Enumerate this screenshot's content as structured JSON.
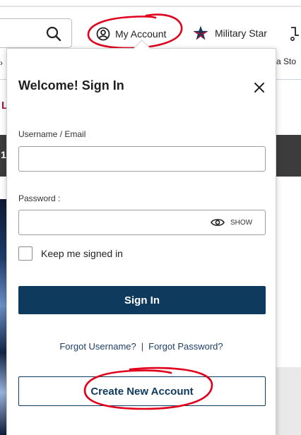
{
  "header": {
    "account_label": "My Account",
    "star_label": "Military Star"
  },
  "background": {
    "nav_left_glyph": "›",
    "nav_right_text": "a Sto",
    "red_letter": "L",
    "strip_digit": "1"
  },
  "signin": {
    "title": "Welcome! Sign In",
    "username_label": "Username / Email",
    "username_value": "",
    "password_label": "Password :",
    "password_value": "",
    "show_label": "SHOW",
    "remember_label": "Keep me signed in",
    "remember_checked": false,
    "submit_label": "Sign In",
    "forgot_username": "Forgot Username?",
    "separator": "|",
    "forgot_password": "Forgot Password?",
    "create_label": "Create New Account"
  },
  "colors": {
    "primary_button": "#0e3a5e",
    "link": "#1d3e66",
    "annotation_red": "#e0001b",
    "star_red": "#c8102e",
    "star_blue": "#1b365d"
  }
}
